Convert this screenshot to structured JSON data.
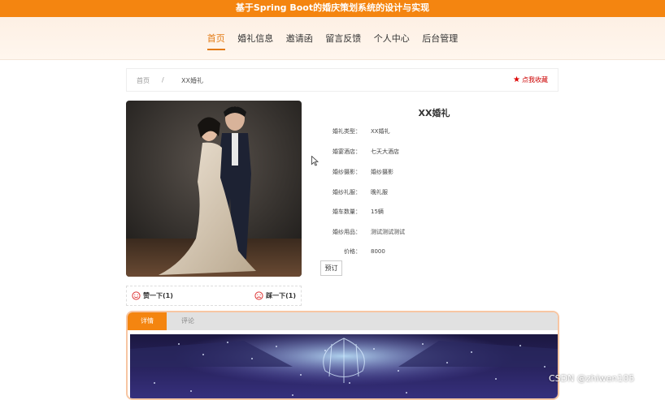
{
  "app": {
    "title": "基于Spring Boot的婚庆策划系统的设计与实现"
  },
  "nav": {
    "items": [
      {
        "label": "首页",
        "active": true
      },
      {
        "label": "婚礼信息",
        "active": false
      },
      {
        "label": "邀请函",
        "active": false
      },
      {
        "label": "留言反馈",
        "active": false
      },
      {
        "label": "个人中心",
        "active": false
      },
      {
        "label": "后台管理",
        "active": false
      }
    ]
  },
  "breadcrumb": {
    "home": "首页",
    "separator": "/",
    "current": "XX婚礼"
  },
  "favorite": {
    "label": "点我收藏",
    "icon": "star-icon"
  },
  "detail": {
    "title": "XX婚礼",
    "fields": [
      {
        "label": "婚礼类型：",
        "value": "XX婚礼"
      },
      {
        "label": "婚宴酒店：",
        "value": "七天大酒店"
      },
      {
        "label": "婚纱摄影：",
        "value": "婚纱摄影"
      },
      {
        "label": "婚纱礼服：",
        "value": "晚礼服"
      },
      {
        "label": "婚车数量：",
        "value": "15辆"
      },
      {
        "label": "婚纱用品：",
        "value": "测试测试测试"
      },
      {
        "label": "价格：",
        "value": "8000"
      }
    ],
    "book_label": "预订"
  },
  "votes": {
    "like_label": "赞一下(1)",
    "dislike_label": "踩一下(1)"
  },
  "tabs": [
    {
      "label": "详情",
      "active": true
    },
    {
      "label": "评论",
      "active": false
    }
  ],
  "watermark": "CSDN @zhiwen105",
  "colors": {
    "accent": "#f48510",
    "nav_bg": "#fdf0e4",
    "favorite": "#cc0000"
  }
}
